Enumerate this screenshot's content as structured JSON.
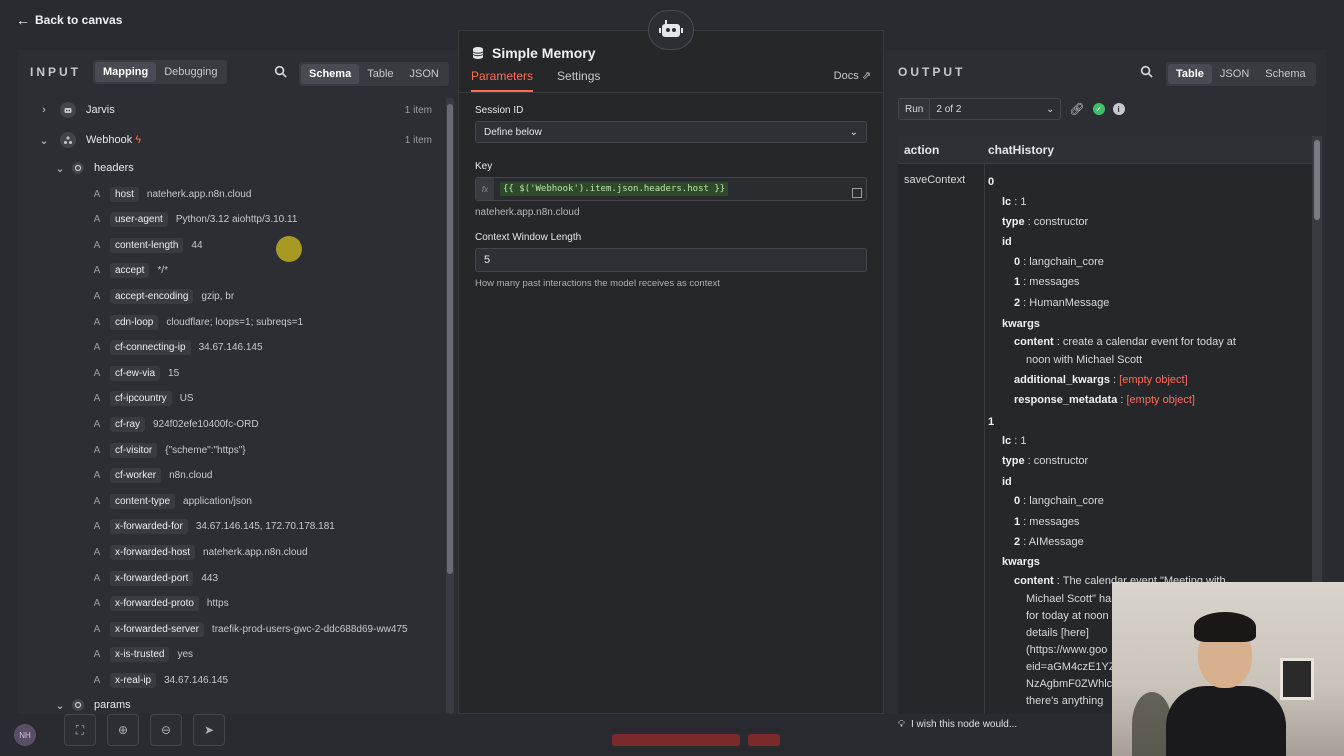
{
  "topbar": {
    "back_label": "Back to canvas"
  },
  "input": {
    "title": "INPUT",
    "mode_tabs": [
      "Mapping",
      "Debugging"
    ],
    "view_tabs": [
      "Schema",
      "Table",
      "JSON"
    ],
    "nodes": [
      {
        "name": "Jarvis",
        "count": "1 item"
      },
      {
        "name": "Webhook",
        "count": "1 item"
      }
    ],
    "headers_label": "headers",
    "fields": [
      {
        "type": "A",
        "key": "host",
        "value": "nateherk.app.n8n.cloud"
      },
      {
        "type": "A",
        "key": "user-agent",
        "value": "Python/3.12 aiohttp/3.10.11"
      },
      {
        "type": "A",
        "key": "content-length",
        "value": "44"
      },
      {
        "type": "A",
        "key": "accept",
        "value": "*/*"
      },
      {
        "type": "A",
        "key": "accept-encoding",
        "value": "gzip, br"
      },
      {
        "type": "A",
        "key": "cdn-loop",
        "value": "cloudflare; loops=1; subreqs=1"
      },
      {
        "type": "A",
        "key": "cf-connecting-ip",
        "value": "34.67.146.145"
      },
      {
        "type": "A",
        "key": "cf-ew-via",
        "value": "15"
      },
      {
        "type": "A",
        "key": "cf-ipcountry",
        "value": "US"
      },
      {
        "type": "A",
        "key": "cf-ray",
        "value": "924f02efe10400fc-ORD"
      },
      {
        "type": "A",
        "key": "cf-visitor",
        "value": "{\"scheme\":\"https\"}"
      },
      {
        "type": "A",
        "key": "cf-worker",
        "value": "n8n.cloud"
      },
      {
        "type": "A",
        "key": "content-type",
        "value": "application/json"
      },
      {
        "type": "A",
        "key": "x-forwarded-for",
        "value": "34.67.146.145, 172.70.178.181"
      },
      {
        "type": "A",
        "key": "x-forwarded-host",
        "value": "nateherk.app.n8n.cloud"
      },
      {
        "type": "A",
        "key": "x-forwarded-port",
        "value": "443"
      },
      {
        "type": "A",
        "key": "x-forwarded-proto",
        "value": "https"
      },
      {
        "type": "A",
        "key": "x-forwarded-server",
        "value": "traefik-prod-users-gwc-2-ddc688d69-ww475"
      },
      {
        "type": "A",
        "key": "x-is-trusted",
        "value": "yes"
      },
      {
        "type": "A",
        "key": "x-real-ip",
        "value": "34.67.146.145"
      }
    ],
    "params_label": "params"
  },
  "center": {
    "title": "Simple Memory",
    "tabs": [
      "Parameters",
      "Settings"
    ],
    "docs_label": "Docs",
    "session_id_label": "Session ID",
    "session_id_value": "Define below",
    "key_label": "Key",
    "key_fx": "fx",
    "key_expression": "{{ $('Webhook').item.json.headers.host }}",
    "key_resolved": "nateherk.app.n8n.cloud",
    "ctx_label": "Context Window Length",
    "ctx_value": "5",
    "ctx_hint": "How many past interactions the model receives as context"
  },
  "output": {
    "title": "OUTPUT",
    "view_tabs": [
      "Table",
      "JSON",
      "Schema"
    ],
    "run_label": "Run",
    "run_value": "2 of 2",
    "columns": [
      "action",
      "chatHistory"
    ],
    "action_value": "saveContext",
    "lines": [
      {
        "k": "0",
        "v": ""
      },
      {
        "k": "lc",
        "v": "1"
      },
      {
        "k": "type",
        "v": "constructor"
      },
      {
        "k": "id",
        "v": ""
      },
      {
        "k": "0",
        "v": "langchain_core"
      },
      {
        "k": "1",
        "v": "messages"
      },
      {
        "k": "2",
        "v": "HumanMessage"
      },
      {
        "k": "kwargs",
        "v": ""
      },
      {
        "k": "content",
        "v": "create a calendar event for today at"
      },
      {
        "k": "",
        "v": "noon with Michael Scott"
      },
      {
        "k": "additional_kwargs",
        "v": "[empty object]"
      },
      {
        "k": "response_metadata",
        "v": "[empty object]"
      },
      {
        "k": "1",
        "v": ""
      },
      {
        "k": "lc",
        "v": "1"
      },
      {
        "k": "type",
        "v": "constructor"
      },
      {
        "k": "id",
        "v": ""
      },
      {
        "k": "0",
        "v": "langchain_core"
      },
      {
        "k": "1",
        "v": "messages"
      },
      {
        "k": "2",
        "v": "AIMessage"
      },
      {
        "k": "kwargs",
        "v": ""
      },
      {
        "k": "content",
        "v": "The calendar event \"Meeting with"
      },
      {
        "k": "",
        "v": "Michael Scott\" ha"
      },
      {
        "k": "",
        "v": "for today at noon"
      },
      {
        "k": "",
        "v": "details [here]"
      },
      {
        "k": "",
        "v": "(https://www.goo"
      },
      {
        "k": "",
        "v": "eid=aGM4czE1YZ"
      },
      {
        "k": "",
        "v": "NzAgbmF0ZWhlc"
      },
      {
        "k": "",
        "v": "there's anything"
      }
    ],
    "feedback": "I wish this node would..."
  },
  "bottom": {
    "avatar_initials": "NH"
  },
  "colors": {
    "accent": "#ff6d5a",
    "success": "#3fbf6a",
    "bg": "#2a2b30"
  }
}
